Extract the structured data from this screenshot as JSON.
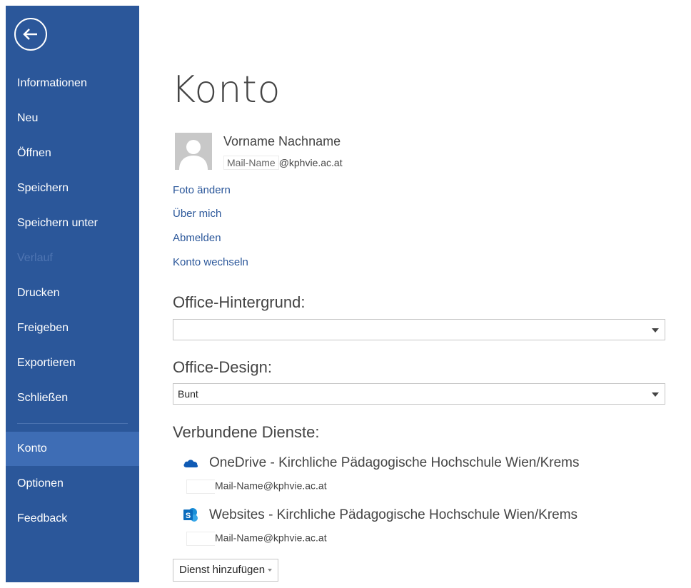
{
  "nav": {
    "back_icon": "arrow-left-circle-icon",
    "items": [
      {
        "label": "Informationen",
        "state": "normal"
      },
      {
        "label": "Neu",
        "state": "normal"
      },
      {
        "label": "Öffnen",
        "state": "normal"
      },
      {
        "label": "Speichern",
        "state": "normal"
      },
      {
        "label": "Speichern unter",
        "state": "normal"
      },
      {
        "label": "Verlauf",
        "state": "disabled"
      },
      {
        "label": "Drucken",
        "state": "normal"
      },
      {
        "label": "Freigeben",
        "state": "normal"
      },
      {
        "label": "Exportieren",
        "state": "normal"
      },
      {
        "label": "Schließen",
        "state": "normal"
      },
      {
        "label": "Konto",
        "state": "active"
      },
      {
        "label": "Optionen",
        "state": "normal"
      },
      {
        "label": "Feedback",
        "state": "normal"
      }
    ]
  },
  "account": {
    "title": "Konto",
    "user_name": "Vorname Nachname",
    "mail_name": "Mail-Name",
    "mail_domain": "@kphvie.ac.at",
    "links": {
      "change_photo": "Foto ändern",
      "about_me": "Über mich",
      "sign_out": "Abmelden",
      "switch_account": "Konto wechseln"
    }
  },
  "office_background": {
    "label": "Office-Hintergrund:",
    "value": ""
  },
  "office_design": {
    "label": "Office-Design:",
    "value": "Bunt"
  },
  "connected_services": {
    "label": "Verbundene Dienste:",
    "services": [
      {
        "icon": "onedrive-cloud-icon",
        "name": "OneDrive - Kirchliche Pädagogische Hochschule Wien/Krems",
        "mail_name": "Mail-Name",
        "mail_domain": "@kphvie.ac.at"
      },
      {
        "icon": "sharepoint-icon",
        "name": "Websites - Kirchliche Pädagogische Hochschule Wien/Krems",
        "mail_name": "Mail-Name",
        "mail_domain": "@kphvie.ac.at"
      }
    ],
    "add_button": "Dienst hinzufügen"
  },
  "colors": {
    "sidebar": "#2b579a",
    "sidebar_active": "#3e6db5",
    "link": "#2b579a",
    "onedrive": "#0f5ab4",
    "sharepoint": "#0b6cbd"
  }
}
